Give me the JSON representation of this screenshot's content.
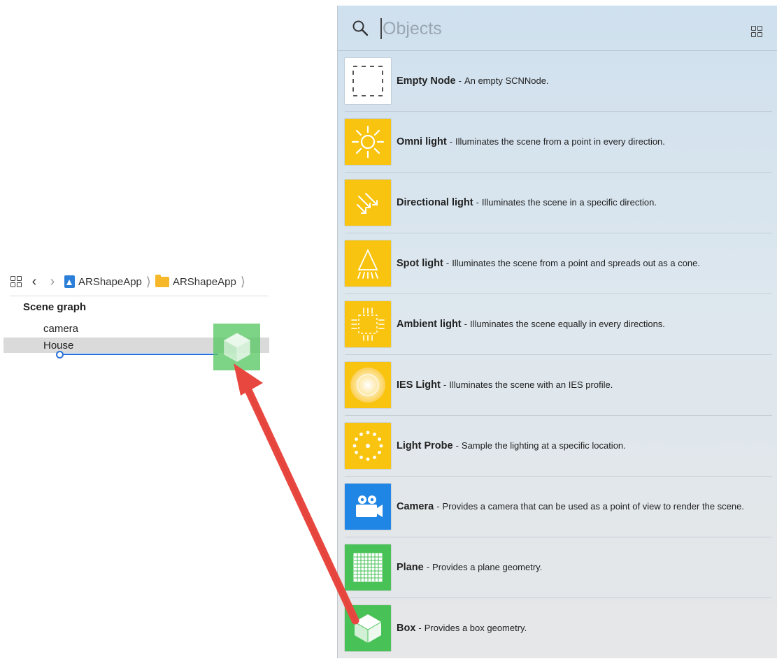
{
  "navigator": {
    "breadcrumb": [
      "ARShapeApp",
      "ARShapeApp"
    ],
    "scene_graph_title": "Scene graph",
    "nodes": [
      "camera",
      "House"
    ]
  },
  "library": {
    "search_placeholder": "Objects",
    "items": [
      {
        "name": "Empty Node",
        "description": "An empty SCNNode.",
        "icon": "empty-node-icon"
      },
      {
        "name": "Omni light",
        "description": "Illuminates the scene from a point in every direction.",
        "icon": "omni-light-icon"
      },
      {
        "name": "Directional light",
        "description": "Illuminates the scene in a specific direction.",
        "icon": "directional-light-icon"
      },
      {
        "name": "Spot light",
        "description": "Illuminates the scene from a point and spreads out as a cone.",
        "icon": "spot-light-icon"
      },
      {
        "name": "Ambient light",
        "description": "Illuminates the scene equally in every directions.",
        "icon": "ambient-light-icon"
      },
      {
        "name": "IES Light",
        "description": "Illuminates the scene with an IES profile.",
        "icon": "ies-light-icon"
      },
      {
        "name": "Light Probe",
        "description": "Sample the lighting at a specific location.",
        "icon": "light-probe-icon"
      },
      {
        "name": "Camera",
        "description": "Provides a camera that can be used as a point of view to render the scene.",
        "icon": "camera-icon"
      },
      {
        "name": "Plane",
        "description": "Provides a plane geometry.",
        "icon": "plane-icon"
      },
      {
        "name": "Box",
        "description": "Provides a box geometry.",
        "icon": "box-icon"
      }
    ]
  },
  "colors": {
    "light_tile": "#f9c40f",
    "camera_tile": "#1f86e6",
    "geometry_tile": "#48c257",
    "drop_indicator": "#2a6fd6",
    "drag_arrow": "#e8473f"
  }
}
